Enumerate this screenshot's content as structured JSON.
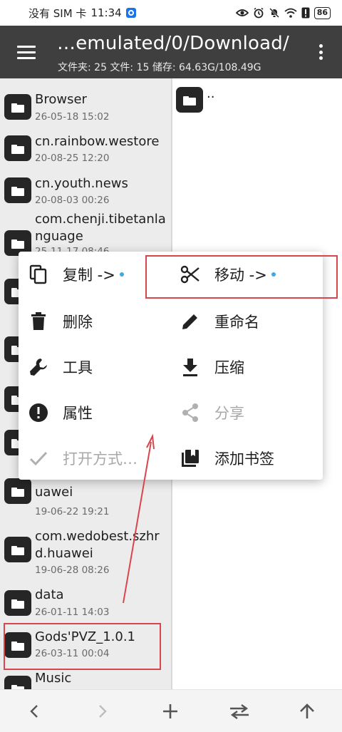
{
  "status_bar": {
    "carrier": "没有 SIM 卡",
    "time": "11:34",
    "battery": "86"
  },
  "header": {
    "title": "…emulated/0/Download/",
    "subtitle": "文件夹: 25  文件: 15  储存: 64.63G/108.49G"
  },
  "left_pane": {
    "items": [
      {
        "name": "Browser",
        "date": "26-05-18 15:02"
      },
      {
        "name": "cn.rainbow.westore",
        "date": "20-08-25 12:20"
      },
      {
        "name": "cn.youth.news",
        "date": "20-08-03 00:26"
      },
      {
        "name": "com.chenji.tibetanlanguage",
        "date": "25-11-17 08:46"
      },
      {
        "name": "com.wedobest.hfu.huawei",
        "date": "19-06-22 19:21"
      },
      {
        "name": "com.wedobest.szhrd.huawei",
        "date": "19-06-28 08:26"
      },
      {
        "name": "data",
        "date": "26-01-11 14:03"
      },
      {
        "name": "Gods'PVZ_1.0.1",
        "date": "26-03-11 00:04"
      },
      {
        "name": "Music",
        "date": ""
      }
    ]
  },
  "right_pane": {
    "items": [
      {
        "name": ".."
      }
    ]
  },
  "context_menu": {
    "copy": "复制 ->",
    "move": "移动 ->",
    "delete": "删除",
    "rename": "重命名",
    "tools": "工具",
    "compress": "压缩",
    "properties": "属性",
    "share": "分享",
    "open_with": "打开方式…",
    "add_bookmark": "添加书签"
  },
  "bottom_bar": {
    "buttons": [
      "back-icon",
      "forward-icon",
      "add-icon",
      "swap-icon",
      "up-icon"
    ]
  },
  "colors": {
    "appbar": "#3f3f3f",
    "highlight": "#d8454c",
    "accent_dot": "#3fa8e6"
  }
}
